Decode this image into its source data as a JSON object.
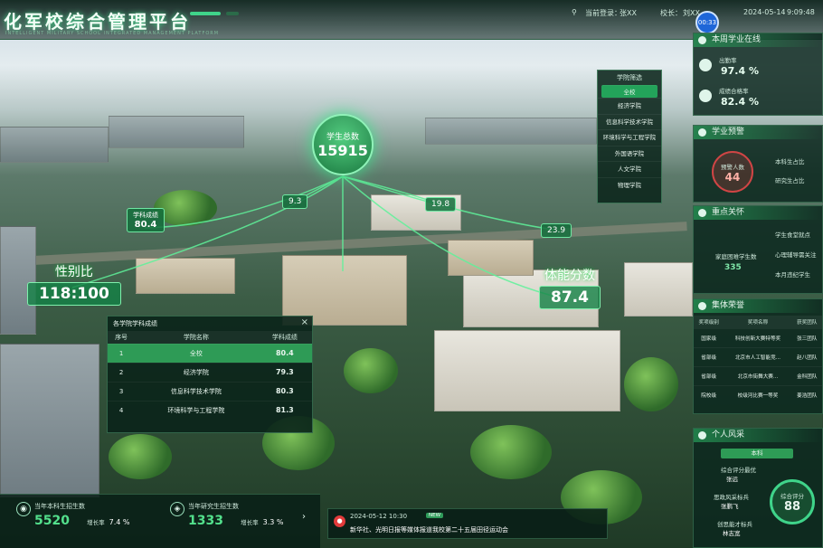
{
  "header": {
    "title": "化军校综合管理平台",
    "subtitle": "INTELLIGENT MILITARY SCHOOL INTEGRATED MANAGEMENT PLATFORM",
    "user_label": "当前登录：",
    "user_name": "张XX",
    "school_label": "校长：",
    "school_name": "刘XX",
    "date": "2024-05-14",
    "time": "9:09:48",
    "clock_badge": "00:33"
  },
  "map": {
    "total_label": "学生总数",
    "total_value": "15915",
    "tag_a": "9.3",
    "tag_b": "19.8",
    "tag_c": "23.9",
    "tag_score_label": "学科成绩",
    "tag_score_value": "80.4",
    "gender_label": "性别比",
    "gender_value": "118:100",
    "fitness_label": "体能分数",
    "fitness_value": "87.4"
  },
  "college_filter": {
    "title": "学院筛选",
    "items": [
      "全校",
      "经济学院",
      "信息科学技术学院",
      "环境科学与工程学院",
      "外国语学院",
      "人文学院",
      "物理学院"
    ]
  },
  "score_panel": {
    "title": "各学院学科成绩",
    "close": "×",
    "headers": [
      "序号",
      "学院名称",
      "学科成绩"
    ],
    "rows": [
      {
        "idx": "1",
        "name": "全校",
        "score": "80.4"
      },
      {
        "idx": "2",
        "name": "经济学院",
        "score": "79.3"
      },
      {
        "idx": "3",
        "name": "信息科学技术学院",
        "score": "80.3"
      },
      {
        "idx": "4",
        "name": "环境科学与工程学院",
        "score": "81.3"
      }
    ]
  },
  "right": {
    "online_title": "本周学业在线",
    "online_a_label": "出勤率",
    "online_a_value": "97.4 %",
    "online_b_label": "成绩合格率",
    "online_b_value": "82.4 %",
    "warn_title": "学业预警",
    "warn_label": "预警人数",
    "warn_value": "44",
    "warn_side1": "本科生占比",
    "warn_side2": "研究生占比",
    "care_title": "重点关怀",
    "care_a": "学生食堂就点",
    "care_b": "家庭困难学生数",
    "care_c": "心理辅导需关注",
    "care_d": "本月违纪学生",
    "care_value": "335",
    "honor_title": "集体荣誉",
    "honor_headers": [
      "奖项级别",
      "奖项名称",
      "获奖团队"
    ],
    "honor_rows": [
      [
        "国家级",
        "科技创新大赛特等奖",
        "张三团队"
      ],
      [
        "省部级",
        "北京市人工智能竞...",
        "赵八团队"
      ],
      [
        "省部级",
        "北京市街舞大赛...",
        "金科团队"
      ],
      [
        "院校级",
        "校级河比赛一等奖",
        "姜浩团队"
      ]
    ],
    "person_title": "个人风采",
    "person_tab": "本科",
    "person_a_label": "综合评分最优",
    "person_a_name": "张远",
    "person_b_label": "思政风采标兵",
    "person_b_name": "张鹏飞",
    "person_c_label": "创思能才标兵",
    "person_c_name": "林志宽",
    "score_ring_label": "综合评分",
    "score_ring_value": "88"
  },
  "bottom": {
    "ug_label": "当年本科生招生数",
    "ug_value": "5520",
    "ug_rate_label": "增长率",
    "ug_rate": "7.4 %",
    "pg_label": "当年研究生招生数",
    "pg_value": "1333",
    "pg_rate_label": "增长率",
    "pg_rate": "3.3 %",
    "arrow": "›"
  },
  "news": {
    "datetime": "2024-05-12 10:30",
    "badge": "NEW",
    "text": "新华社、光明日报等媒体报道我校第二十五届田径运动会"
  }
}
